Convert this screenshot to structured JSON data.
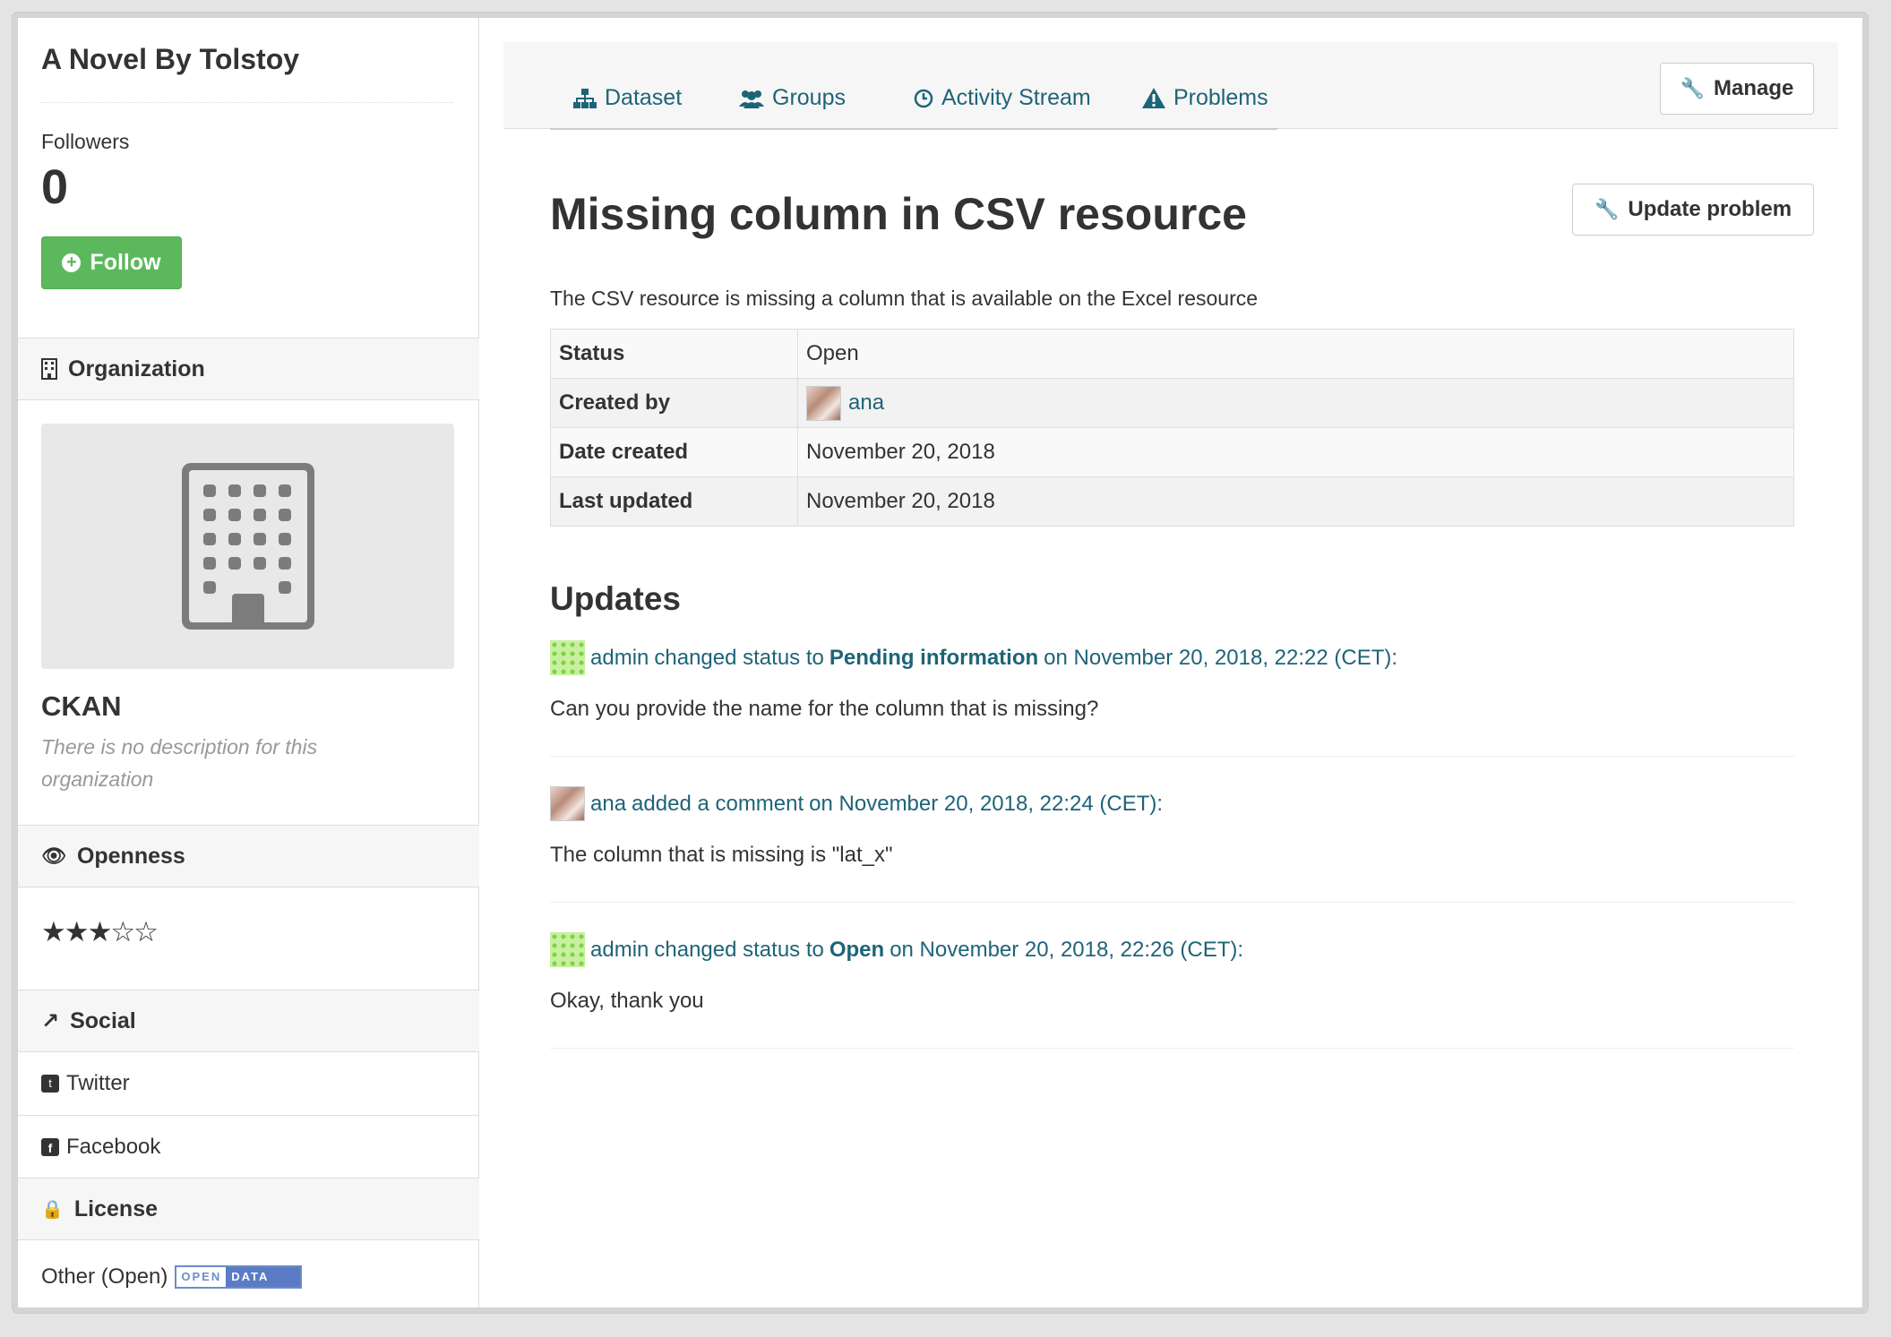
{
  "sidebar": {
    "title": "A Novel By Tolstoy",
    "followers_label": "Followers",
    "followers_count": "0",
    "follow_label": "Follow",
    "organization_heading": "Organization",
    "org_name": "CKAN",
    "org_description": "There is no description for this organization",
    "openness_heading": "Openness",
    "openness_stars": "★★★☆☆",
    "openness_rating": 3,
    "social_heading": "Social",
    "social_items": [
      "Twitter",
      "Facebook"
    ],
    "license_heading": "License",
    "license_text": "Other (Open)",
    "license_badge": [
      "OPEN",
      "DATA"
    ]
  },
  "tabs": [
    {
      "label": "Dataset",
      "icon": "sitemap-icon"
    },
    {
      "label": "Groups",
      "icon": "users-icon"
    },
    {
      "label": "Activity Stream",
      "icon": "clock-icon"
    },
    {
      "label": "Problems",
      "icon": "warning-icon"
    }
  ],
  "manage_label": "Manage",
  "update_problem_label": "Update problem",
  "problem": {
    "title": "Missing column in CSV resource",
    "description": "The CSV resource is missing a column that is available on the Excel resource",
    "rows": [
      {
        "key": "Status",
        "value": "Open"
      },
      {
        "key": "Created by",
        "value": "ana"
      },
      {
        "key": "Date created",
        "value": "November 20, 2018"
      },
      {
        "key": "Last updated",
        "value": "November 20, 2018"
      }
    ]
  },
  "updates_title": "Updates",
  "updates": [
    {
      "user": "admin",
      "pre": "changed status to",
      "status": "Pending information",
      "post": "on November 20, 2018, 22:22 (CET):",
      "body": "Can you provide the name for the column that is missing?"
    },
    {
      "user": "ana",
      "pre": "added a comment",
      "status": "",
      "post": "on November 20, 2018, 22:24 (CET):",
      "body": "The column that is missing is \"lat_x\""
    },
    {
      "user": "admin",
      "pre": "changed status to",
      "status": "Open",
      "post": "on November 20, 2018, 22:26 (CET):",
      "body": "Okay, thank you"
    }
  ],
  "colors": {
    "link": "#1e6478",
    "follow": "#5cb85c"
  }
}
